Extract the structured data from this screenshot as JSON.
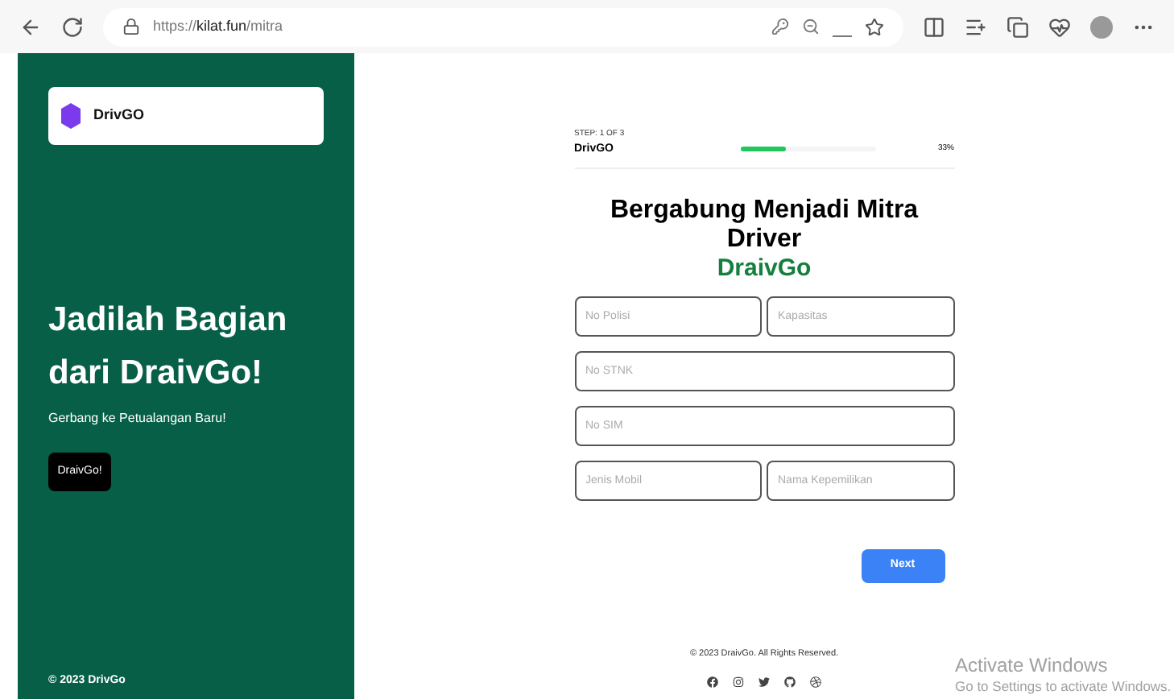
{
  "browser": {
    "url_prefix": "https://",
    "url_host": "kilat.fun",
    "url_path": "/mitra"
  },
  "sidebar": {
    "brand": "DrivGO",
    "heading": "Jadilah Bagian dari DraivGo!",
    "tagline": "Gerbang ke Petualangan Baru!",
    "button": "DraivGo!",
    "footer": "© 2023 DrivGo"
  },
  "progress": {
    "step": "STEP: 1 OF 3",
    "name": "DrivGO",
    "level": 0.33,
    "reading": "33%"
  },
  "form": {
    "title": "Bergabung Menjadi Mitra Driver",
    "brand": "DraivGo",
    "rows": [
      {
        "fields": [
          {
            "placeholder": "No Polisi"
          },
          {
            "placeholder": "Kapasitas"
          }
        ]
      },
      {
        "fields": [
          {
            "placeholder": "No STNK"
          }
        ]
      },
      {
        "fields": [
          {
            "placeholder": "No SIM"
          }
        ]
      },
      {
        "fields": [
          {
            "placeholder": "Jenis Mobil"
          },
          {
            "placeholder": "Nama Kepemilikan"
          }
        ]
      }
    ],
    "button": "Next"
  },
  "footer": {
    "text": "© 2023 DraivGo. All Rights Reserved.",
    "social": [
      {
        "kind": "facebook"
      },
      {
        "kind": "instagram"
      },
      {
        "kind": "twitter"
      },
      {
        "kind": "github"
      },
      {
        "kind": "dribbble"
      }
    ]
  },
  "os_notice": {
    "title": "Activate Windows",
    "text": "Go to Settings to activate Windows."
  }
}
